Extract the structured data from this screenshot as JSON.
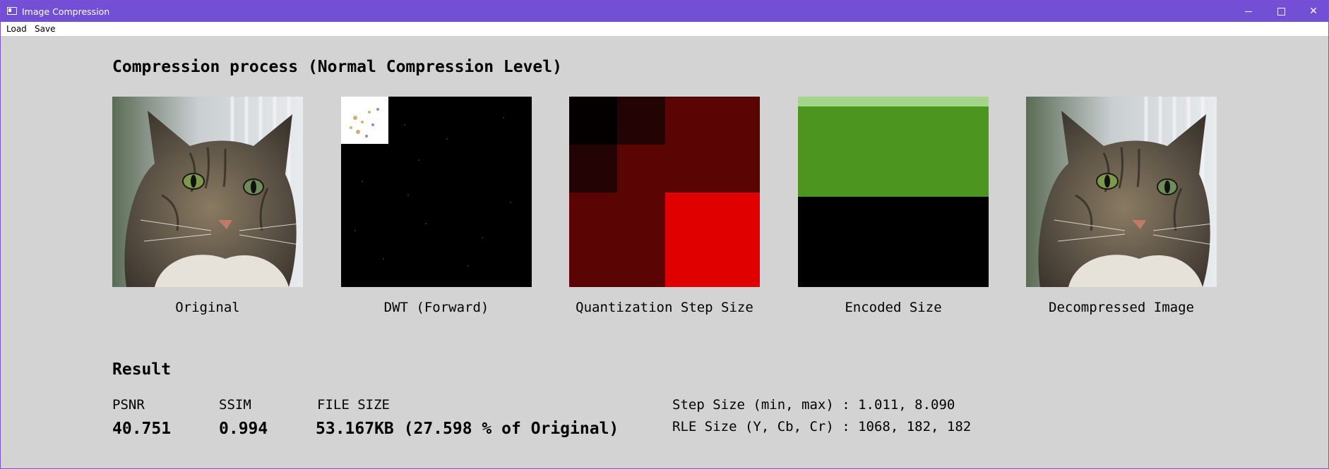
{
  "window": {
    "title": "Image Compression",
    "accent_color": "#734fd5",
    "controls": [
      "minimize-icon",
      "maximize-icon",
      "close-icon"
    ]
  },
  "menu": {
    "load": "Load",
    "save": "Save"
  },
  "process": {
    "title": "Compression process (Normal Compression Level)",
    "captions": {
      "original": "Original",
      "dwt": "DWT (Forward)",
      "quant": "Quantization Step Size",
      "encoded": "Encoded Size",
      "decompressed": "Decompressed Image"
    },
    "quant_colors": [
      "#050000",
      "#230303",
      "#5a0404",
      "#e00000"
    ],
    "encoded_colors": [
      "#a3d68a",
      "#4c951f",
      "#000000"
    ]
  },
  "result": {
    "title": "Result",
    "psnr_label": "PSNR",
    "psnr_value": "40.751",
    "ssim_label": "SSIM",
    "ssim_value": "0.994",
    "filesize_label": "FILE SIZE",
    "filesize_value": "53.167KB (27.598 % of Original)",
    "step_size": "Step Size (min, max) : 1.011, 8.090",
    "rle_size": "RLE Size (Y, Cb, Cr) : 1068, 182, 182"
  }
}
